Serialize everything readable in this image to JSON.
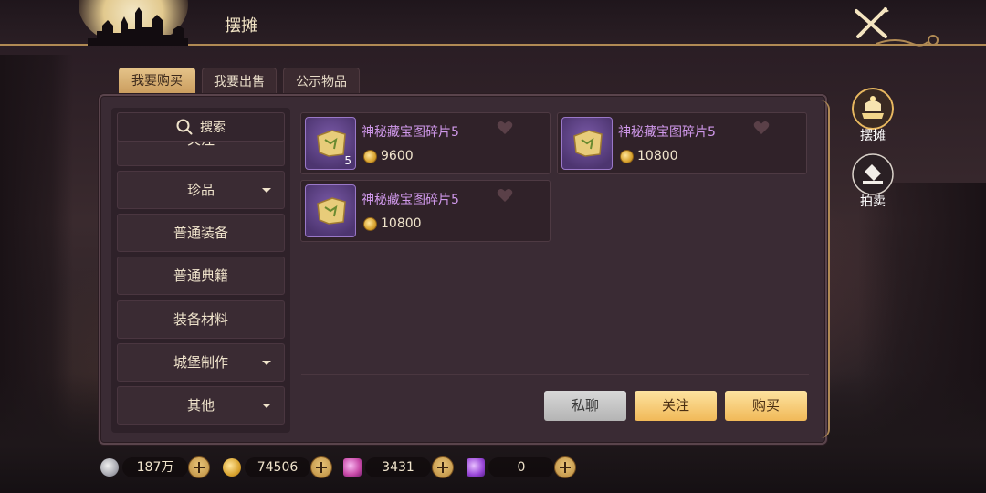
{
  "header": {
    "title": "摆摊"
  },
  "tabs": [
    {
      "label": "我要购买",
      "active": true
    },
    {
      "label": "我要出售",
      "active": false
    },
    {
      "label": "公示物品",
      "active": false
    }
  ],
  "sidebar": {
    "search_label": "搜索",
    "categories": [
      {
        "label": "关注",
        "has_dropdown": false
      },
      {
        "label": "珍品",
        "has_dropdown": true
      },
      {
        "label": "普通装备",
        "has_dropdown": false
      },
      {
        "label": "普通典籍",
        "has_dropdown": false
      },
      {
        "label": "装备材料",
        "has_dropdown": false
      },
      {
        "label": "城堡制作",
        "has_dropdown": true
      },
      {
        "label": "其他",
        "has_dropdown": true
      }
    ]
  },
  "items": [
    {
      "name": "神秘藏宝图碎片5",
      "price": "9600",
      "quantity": "5"
    },
    {
      "name": "神秘藏宝图碎片5",
      "price": "10800",
      "quantity": ""
    },
    {
      "name": "神秘藏宝图碎片5",
      "price": "10800",
      "quantity": ""
    }
  ],
  "actions": {
    "chat_label": "私聊",
    "follow_label": "关注",
    "buy_label": "购买"
  },
  "side_nav": [
    {
      "label": "摆摊",
      "active": true,
      "icon": "stall-icon"
    },
    {
      "label": "拍卖",
      "active": false,
      "icon": "auction-icon"
    }
  ],
  "currencies": [
    {
      "icon": "silver-coin-icon",
      "value": "187万"
    },
    {
      "icon": "gold-coin-icon",
      "value": "74506"
    },
    {
      "icon": "pink-gem-icon",
      "value": "3431"
    },
    {
      "icon": "purple-gem-icon",
      "value": "0"
    }
  ],
  "colors": {
    "accent_gold": "#f1b958",
    "item_name_purple": "#cf98ea",
    "panel_bg": "#3a2b34"
  }
}
